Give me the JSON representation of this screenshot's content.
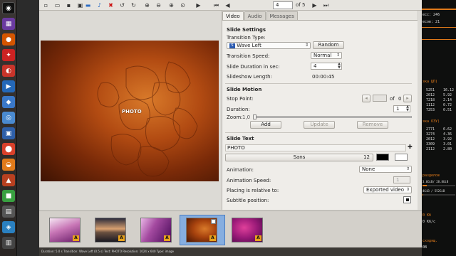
{
  "toolbar": {
    "slide_number": "4",
    "slide_of": "of 5",
    "icons": [
      "new-icon",
      "open-icon",
      "save-icon",
      "save-as-icon",
      "export-icon",
      "music-icon",
      "delete-icon",
      "rotate-left-icon",
      "rotate-right-icon",
      "zoom-in-icon",
      "zoom-out-icon",
      "zoom-fit-icon",
      "zoom-100-icon",
      "play-icon",
      "first-icon",
      "prev-icon",
      "next-icon",
      "last-icon"
    ]
  },
  "preview": {
    "text": "PHOTO"
  },
  "tabs": [
    "Video",
    "Audio",
    "Messages"
  ],
  "slide_settings": {
    "title": "Slide Settings",
    "transition_type_label": "Transition Type:",
    "transition_type_value": "Wave Left",
    "random_label": "Random",
    "transition_speed_label": "Transition Speed:",
    "transition_speed_value": "Normal",
    "duration_label": "Slide Duration in sec:",
    "duration_value": "4",
    "length_label": "Slideshow Length:",
    "length_value": "00:00:45"
  },
  "slide_motion": {
    "title": "Slide Motion",
    "stop_point_label": "Stop Point:",
    "stop_point_of": "of",
    "stop_point_total": "0",
    "duration_label": "Duration:",
    "duration_value": "1",
    "zoom_label": "Zoom:",
    "zoom_value": "1,0",
    "add_label": "Add",
    "update_label": "Update",
    "remove_label": "Remove"
  },
  "slide_text": {
    "title": "Slide Text",
    "text_value": "PHOTO",
    "font_name": "Sans",
    "font_size": "12",
    "text_color": "#000000",
    "bg_color": "#ffffff",
    "animation_label": "Animation:",
    "animation_value": "None",
    "anim_speed_label": "Animation Speed:",
    "anim_speed_value": "1",
    "placing_label": "Placing is relative to:",
    "placing_value": "Exported video",
    "subtitle_label": "Subtitle position:"
  },
  "filmstrip": {
    "badge": "A"
  },
  "statusbar": {
    "text": "Duration: 5.0 s   Transition: Wave Left (0.5 s)   Text: PHOTO   Resolution: 1024 x 640   Type: image"
  },
  "conky": {
    "top_labels": [
      "ecc: 246",
      "ecoв: 21"
    ],
    "cpu_title": "зка ЦП)",
    "cpu_rows": [
      [
        "5251",
        "16.12"
      ],
      [
        "2012",
        "5.92"
      ],
      [
        "7218",
        "2.14"
      ],
      [
        "1112",
        "0.72"
      ],
      [
        "7253",
        "0.51"
      ]
    ],
    "ram_title": "зка ОЗУ)",
    "ram_rows": [
      [
        "2771",
        "6.62"
      ],
      [
        "3274",
        "4.36"
      ],
      [
        "2012",
        "3.92"
      ],
      [
        "3309",
        "3.01"
      ],
      [
        "2112",
        "2.80"
      ]
    ],
    "disk_title": "разделов",
    "disk_values": [
      "3.6GiB/ 28.8GiB",
      "4GiB / 552GiB"
    ],
    "net_title": "0 Кб",
    "net_up": "0 K6/c",
    "net_down_label": "сходящ.",
    "net_down": "0B"
  },
  "colors": {
    "accent": "#e8a21c",
    "selected": "#86aee0",
    "conky_orange": "#e07a1a"
  }
}
